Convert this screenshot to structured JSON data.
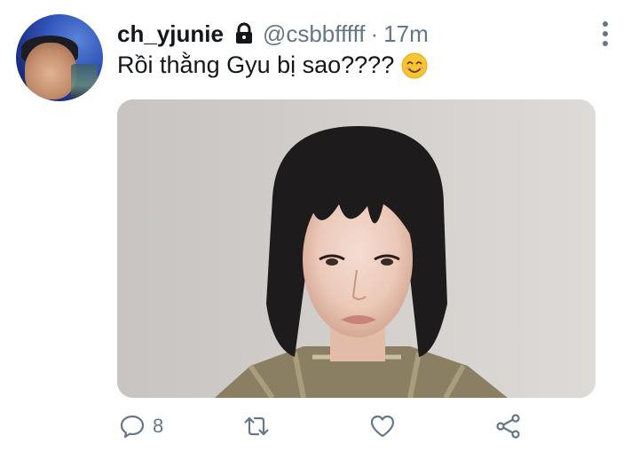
{
  "tweet": {
    "display_name": "ch_yjunie",
    "handle": "@csbbfffff",
    "separator": "·",
    "time": "17m",
    "text": "Rồi thằng Gyu bị sao????",
    "protected_icon": "lock-icon",
    "emoji": "smiling-face-emoji"
  },
  "actions": {
    "reply_count": "8",
    "reply_icon": "comment-icon",
    "retweet_icon": "retweet-icon",
    "like_icon": "heart-icon",
    "share_icon": "share-icon"
  },
  "colors": {
    "text": "#14171a",
    "secondary": "#657786",
    "background": "#ffffff"
  }
}
